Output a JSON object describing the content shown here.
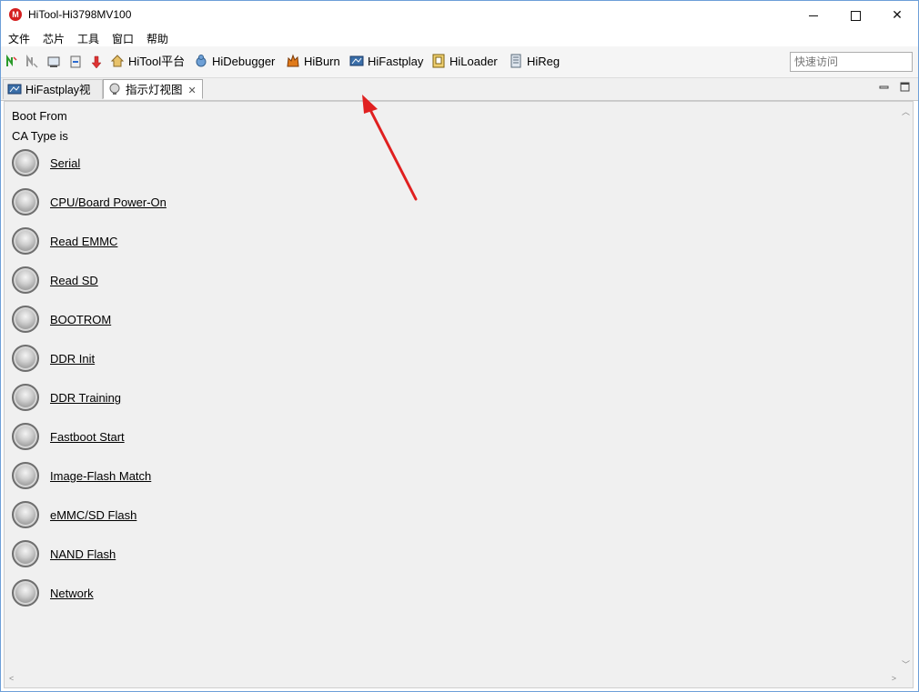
{
  "window": {
    "title": "HiTool-Hi3798MV100",
    "app_icon_glyph": "M"
  },
  "menu": [
    "文件",
    "芯片",
    "工具",
    "窗口",
    "帮助"
  ],
  "toolbar": {
    "tools": [
      {
        "label": "HiTool平台",
        "icon": "home-icon"
      },
      {
        "label": "HiDebugger",
        "icon": "debugger-icon"
      },
      {
        "label": "HiBurn",
        "icon": "burn-icon"
      },
      {
        "label": "HiFastplay",
        "icon": "fastplay-icon"
      },
      {
        "label": "HiLoader",
        "icon": "loader-icon"
      },
      {
        "label": "HiReg",
        "icon": "register-icon"
      }
    ],
    "quick_access_placeholder": "快速访问"
  },
  "tabs": [
    {
      "label": "HiFastplay视图",
      "active": false
    },
    {
      "label": "指示灯视图",
      "active": true,
      "close": "✕"
    }
  ],
  "content": {
    "boot_from": "Boot From",
    "ca_type": "CA Type is",
    "leds": [
      "Serial",
      "CPU/Board Power-On",
      "Read EMMC",
      "Read SD ",
      "BOOTROM",
      "DDR Init",
      "DDR Training",
      "Fastboot Start",
      "Image-Flash Match",
      "eMMC/SD Flash",
      "NAND Flash",
      "Network"
    ],
    "led_color": "#a8a8a8"
  },
  "colors": {
    "annotation_arrow": "#e02020",
    "window_border": "#6d9fd8"
  }
}
